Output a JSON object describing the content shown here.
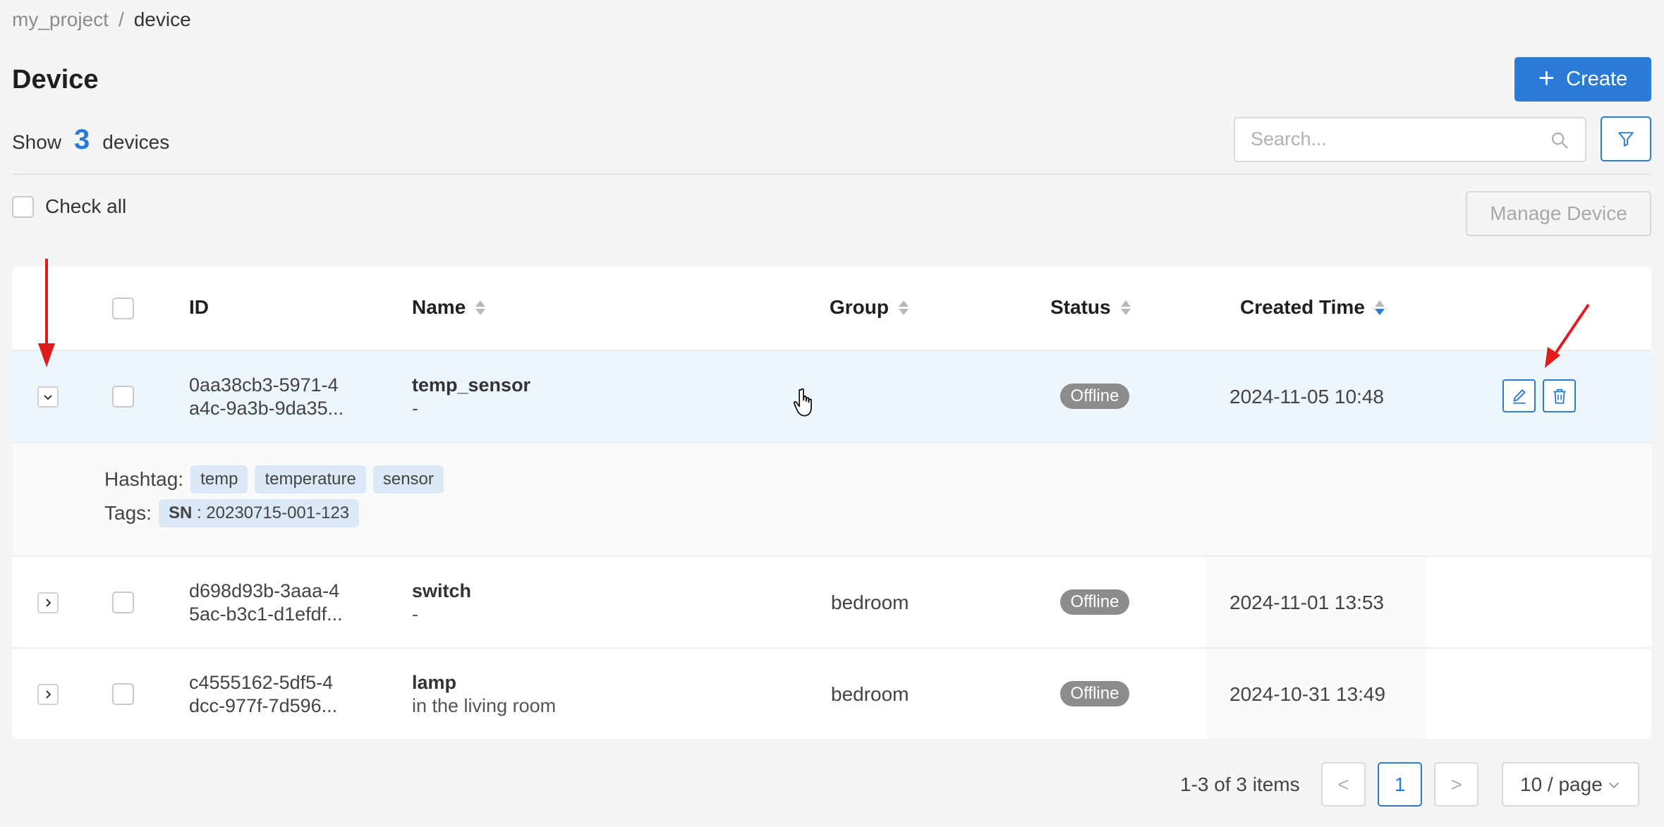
{
  "breadcrumb": {
    "project": "my_project",
    "separator": "/",
    "current": "device"
  },
  "page": {
    "title": "Device",
    "create_label": "Create",
    "create_icon": "plus-icon"
  },
  "summary": {
    "show_label": "Show",
    "count": "3",
    "unit_label": "devices"
  },
  "search": {
    "placeholder": "Search...",
    "value": ""
  },
  "toolbar": {
    "check_all_label": "Check all",
    "manage_label": "Manage Device"
  },
  "table": {
    "columns": {
      "id": "ID",
      "name": "Name",
      "group": "Group",
      "status": "Status",
      "created": "Created Time"
    },
    "rows": [
      {
        "id_line1": "0aa38cb3-5971-4",
        "id_line2": "a4c-9a3b-9da35...",
        "name": "temp_sensor",
        "description": "-",
        "group": "",
        "status": "Offline",
        "created": "2024-11-05 10:48",
        "expanded": true
      },
      {
        "id_line1": "d698d93b-3aaa-4",
        "id_line2": "5ac-b3c1-d1efdf...",
        "name": "switch",
        "description": "-",
        "group": "bedroom",
        "status": "Offline",
        "created": "2024-11-01 13:53"
      },
      {
        "id_line1": "c4555162-5df5-4",
        "id_line2": "dcc-977f-7d596...",
        "name": "lamp",
        "description": "in the living room",
        "group": "bedroom",
        "status": "Offline",
        "created": "2024-10-31 13:49"
      }
    ],
    "expanded_detail": {
      "hashtag_label": "Hashtag:",
      "hashtags": [
        "temp",
        "temperature",
        "sensor"
      ],
      "tags_label": "Tags:",
      "tag_key": "SN",
      "tag_value": ": 20230715-001-123"
    }
  },
  "pagination": {
    "total_text": "1-3 of 3 items",
    "current_page": "1",
    "prev": "<",
    "next": ">",
    "page_size": "10 / page"
  },
  "colors": {
    "primary": "#2a7bd6",
    "status_offline": "#8c8c8c",
    "annotation_arrow": "#e01b1b"
  }
}
